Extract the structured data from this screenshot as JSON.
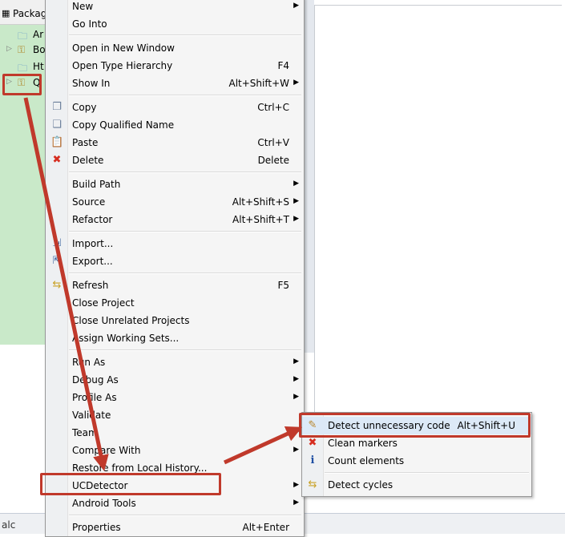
{
  "explorer": {
    "tab_label": "Package",
    "items": [
      {
        "label": "Ar",
        "icon": "folder-icon",
        "twisty": ""
      },
      {
        "label": "Bo",
        "icon": "project-icon",
        "twisty": "▷"
      },
      {
        "label": "Ht",
        "icon": "folder-icon",
        "twisty": ""
      },
      {
        "label": "Q",
        "icon": "project-icon",
        "twisty": "▷"
      }
    ]
  },
  "status_bar": {
    "text": "alc"
  },
  "context_menu": {
    "items": [
      {
        "label": "New",
        "accel": "",
        "submenu": true
      },
      {
        "label": "Go Into",
        "accel": "",
        "submenu": false
      },
      {
        "label": "Open in New Window",
        "accel": "",
        "submenu": false
      },
      {
        "label": "Open Type Hierarchy",
        "accel": "F4",
        "submenu": false
      },
      {
        "label": "Show In",
        "accel": "Alt+Shift+W",
        "submenu": true
      },
      {
        "label": "Copy",
        "accel": "Ctrl+C",
        "submenu": false,
        "icon": "copy-icon"
      },
      {
        "label": "Copy Qualified Name",
        "accel": "",
        "submenu": false,
        "icon": "copy-qualified-name-icon"
      },
      {
        "label": "Paste",
        "accel": "Ctrl+V",
        "submenu": false,
        "icon": "paste-icon"
      },
      {
        "label": "Delete",
        "accel": "Delete",
        "submenu": false,
        "icon": "delete-icon"
      },
      {
        "label": "Build Path",
        "accel": "",
        "submenu": true
      },
      {
        "label": "Source",
        "accel": "Alt+Shift+S",
        "submenu": true
      },
      {
        "label": "Refactor",
        "accel": "Alt+Shift+T",
        "submenu": true
      },
      {
        "label": "Import...",
        "accel": "",
        "submenu": false,
        "icon": "import-icon"
      },
      {
        "label": "Export...",
        "accel": "",
        "submenu": false,
        "icon": "export-icon"
      },
      {
        "label": "Refresh",
        "accel": "F5",
        "submenu": false,
        "icon": "refresh-icon"
      },
      {
        "label": "Close Project",
        "accel": "",
        "submenu": false
      },
      {
        "label": "Close Unrelated Projects",
        "accel": "",
        "submenu": false
      },
      {
        "label": "Assign Working Sets...",
        "accel": "",
        "submenu": false
      },
      {
        "label": "Run As",
        "accel": "",
        "submenu": true
      },
      {
        "label": "Debug As",
        "accel": "",
        "submenu": true
      },
      {
        "label": "Profile As",
        "accel": "",
        "submenu": true
      },
      {
        "label": "Validate",
        "accel": "",
        "submenu": false
      },
      {
        "label": "Team",
        "accel": "",
        "submenu": true
      },
      {
        "label": "Compare With",
        "accel": "",
        "submenu": true
      },
      {
        "label": "Restore from Local History...",
        "accel": "",
        "submenu": false
      },
      {
        "label": "UCDetector",
        "accel": "",
        "submenu": true
      },
      {
        "label": "Android Tools",
        "accel": "",
        "submenu": true
      },
      {
        "label": "Properties",
        "accel": "Alt+Enter",
        "submenu": false
      }
    ]
  },
  "ucdetector_submenu": {
    "items": [
      {
        "label": "Detect unnecessary code",
        "accel": "Alt+Shift+U",
        "icon": "detect-code-icon"
      },
      {
        "label": "Clean markers",
        "accel": "",
        "icon": "clean-markers-icon"
      },
      {
        "label": "Count elements",
        "accel": "",
        "icon": "info-icon"
      },
      {
        "label": "Detect cycles",
        "accel": "",
        "icon": "detect-cycles-icon"
      }
    ]
  },
  "colors": {
    "annotation": "#c0392b",
    "menu_bg": "#f5f5f5",
    "explorer_bg": "#c9e9c9"
  }
}
